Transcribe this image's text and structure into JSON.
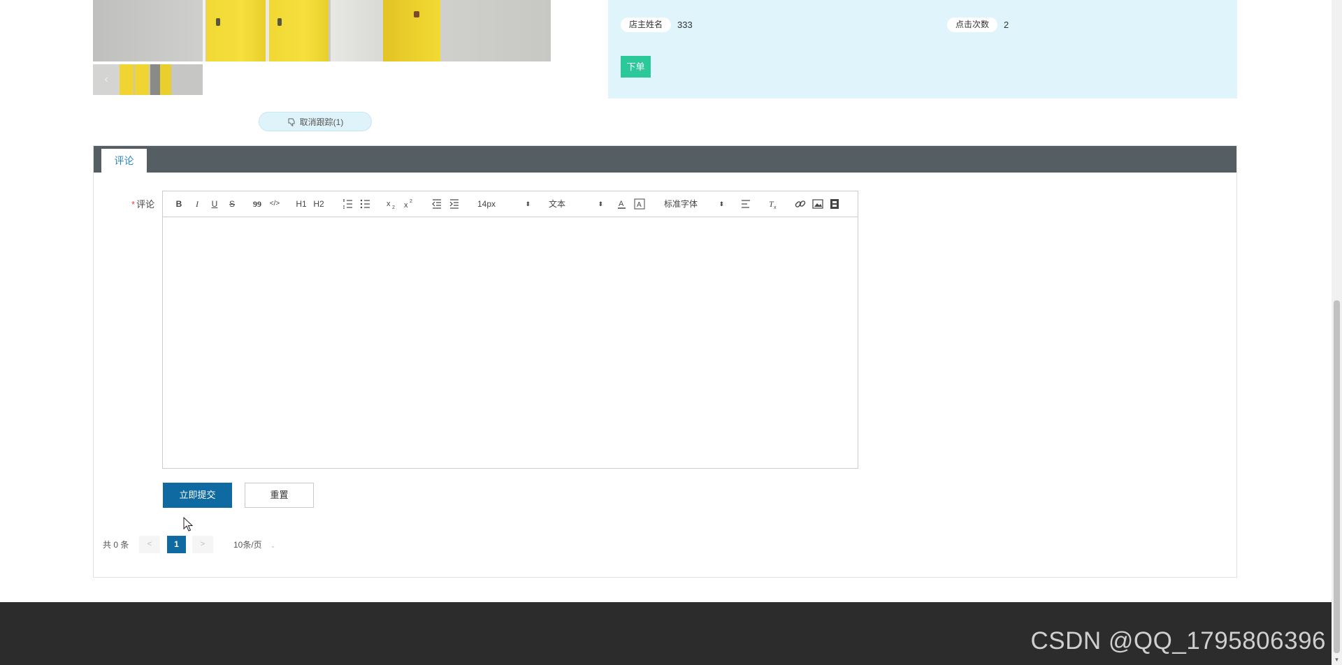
{
  "gallery": {
    "prev_arrow": "‹"
  },
  "follow": {
    "unfollow_label": "取消跟踪(1)"
  },
  "info": {
    "fields": [
      {
        "label": "店主姓名",
        "value": "333"
      },
      {
        "label": "点击次数",
        "value": "2"
      }
    ],
    "order_button": "下单"
  },
  "comment_section": {
    "tab": "评论",
    "required_mark": "*",
    "field_label": "评论",
    "editor": {
      "toolbar": {
        "bold": "B",
        "italic": "I",
        "underline": "U",
        "strike": "S",
        "blockquote": "99",
        "code": "</>",
        "h1": "H1",
        "h2": "H2",
        "font_size": "14px",
        "header_select": "文本",
        "font_family": "标准字体"
      },
      "content": ""
    },
    "submit_button": "立即提交",
    "reset_button": "重置"
  },
  "pagination": {
    "total": "共 0 条",
    "prev": "<",
    "current_page": "1",
    "next": ">",
    "page_size": "10条/页"
  },
  "footer": {
    "watermark": "CSDN @QQ_1795806396"
  },
  "colors": {
    "accent": "#0e6aa0",
    "order_green": "#2bc99a",
    "info_bg": "#dff4fb",
    "tab_bar": "#545e63",
    "footer_bg": "#2c2c2c"
  }
}
